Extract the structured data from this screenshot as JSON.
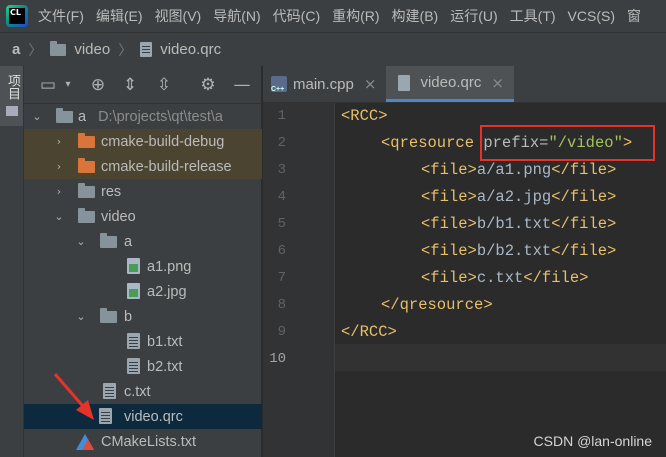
{
  "app": {
    "logo_text": "CL"
  },
  "menu": [
    "文件(F)",
    "编辑(E)",
    "视图(V)",
    "导航(N)",
    "代码(C)",
    "重构(R)",
    "构建(B)",
    "运行(U)",
    "工具(T)",
    "VCS(S)",
    "窗"
  ],
  "breadcrumb": {
    "root": "a",
    "folder": "video",
    "file": "video.qrc"
  },
  "toolstrip": {
    "label": "项目"
  },
  "project_toolbar": {
    "icons": [
      "project-view-icon",
      "locate-icon",
      "expand-all-icon",
      "collapse-all-icon",
      "gear-icon",
      "minimize-icon"
    ]
  },
  "tree": {
    "root_label": "a",
    "root_path": "D:\\projects\\qt\\test\\a",
    "items": [
      {
        "label": "cmake-build-debug"
      },
      {
        "label": "cmake-build-release"
      },
      {
        "label": "res"
      },
      {
        "label": "video"
      },
      {
        "label": "a"
      },
      {
        "label": "a1.png"
      },
      {
        "label": "a2.jpg"
      },
      {
        "label": "b"
      },
      {
        "label": "b1.txt"
      },
      {
        "label": "b2.txt"
      },
      {
        "label": "c.txt"
      },
      {
        "label": "video.qrc"
      },
      {
        "label": "CMakeLists.txt"
      }
    ]
  },
  "tabs": [
    {
      "label": "main.cpp"
    },
    {
      "label": "video.qrc"
    }
  ],
  "editor": {
    "line_numbers": [
      "1",
      "2",
      "3",
      "4",
      "5",
      "6",
      "7",
      "8",
      "9",
      "10"
    ],
    "lines": {
      "l1": "<RCC>",
      "l2_open": "<qresource ",
      "l2_attr": "prefix",
      "l2_eq": "=",
      "l2_val": "\"/video\"",
      "l2_close": ">",
      "l3_open": "<file>",
      "l3_text": "a/a1.png",
      "l3_close": "</file>",
      "l4_open": "<file>",
      "l4_text": "a/a2.jpg",
      "l4_close": "</file>",
      "l5_open": "<file>",
      "l5_text": "b/b1.txt",
      "l5_close": "</file>",
      "l6_open": "<file>",
      "l6_text": "b/b2.txt",
      "l6_close": "</file>",
      "l7_open": "<file>",
      "l7_text": "c.txt",
      "l7_close": "</file>",
      "l8": "</qresource>",
      "l9": "</RCC>"
    }
  },
  "watermark": "CSDN @lan-online",
  "colors": {
    "highlight_box": "#e6332a",
    "arrow": "#e6332a"
  }
}
